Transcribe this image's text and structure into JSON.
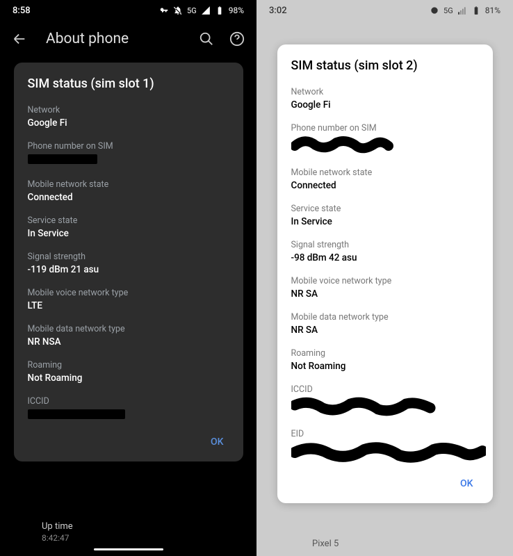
{
  "left": {
    "statusbar": {
      "time": "8:58",
      "net": "5G",
      "battery": "98%"
    },
    "header": {
      "title": "About phone"
    },
    "dialog": {
      "title": "SIM status (sim slot 1)",
      "fields": {
        "network_label": "Network",
        "network_value": "Google Fi",
        "phone_label": "Phone number on SIM",
        "mns_label": "Mobile network state",
        "mns_value": "Connected",
        "svc_label": "Service state",
        "svc_value": "In Service",
        "sig_label": "Signal strength",
        "sig_value": "-119 dBm 21 asu",
        "voice_label": "Mobile voice network type",
        "voice_value": "LTE",
        "data_label": "Mobile data network type",
        "data_value": "NR NSA",
        "roam_label": "Roaming",
        "roam_value": "Not Roaming",
        "iccid_label": "ICCID"
      },
      "ok": "OK"
    },
    "uptime_label": "Up time",
    "uptime_value": "8:42:47"
  },
  "right": {
    "statusbar": {
      "time": "3:02",
      "net": "5G",
      "battery": "81%"
    },
    "dialog": {
      "title": "SIM status (sim slot 2)",
      "fields": {
        "network_label": "Network",
        "network_value": "Google Fi",
        "phone_label": "Phone number on SIM",
        "mns_label": "Mobile network state",
        "mns_value": "Connected",
        "svc_label": "Service state",
        "svc_value": "In Service",
        "sig_label": "Signal strength",
        "sig_value": "-98 dBm 42 asu",
        "voice_label": "Mobile voice network type",
        "voice_value": "NR SA",
        "data_label": "Mobile data network type",
        "data_value": "NR SA",
        "roam_label": "Roaming",
        "roam_value": "Not Roaming",
        "iccid_label": "ICCID",
        "eid_label": "EID"
      },
      "ok": "OK"
    },
    "bg_label": "Pixel 5"
  }
}
